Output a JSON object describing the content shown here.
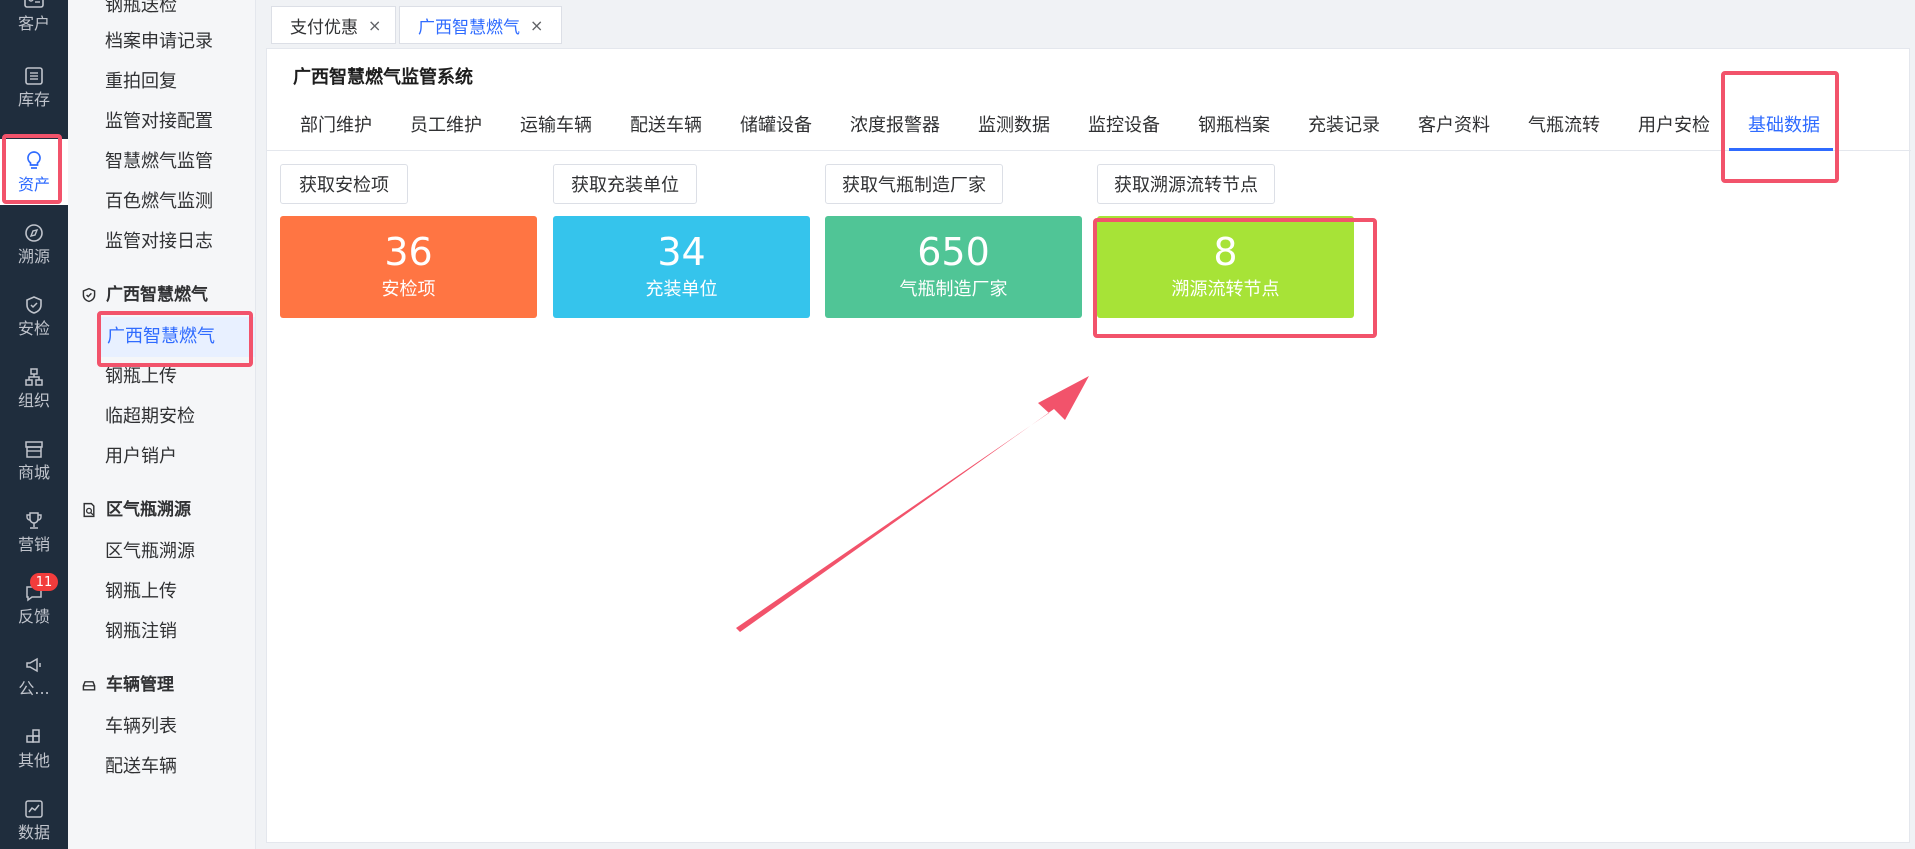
{
  "rail": {
    "items": [
      {
        "label": "",
        "icon": "contact-card-icon"
      },
      {
        "label": "客户",
        "icon": "contact-card-icon"
      },
      {
        "label": "库存",
        "icon": "inventory-icon"
      },
      {
        "label": "资产",
        "icon": "lightbulb-icon",
        "active": true
      },
      {
        "label": "溯源",
        "icon": "compass-icon"
      },
      {
        "label": "安检",
        "icon": "shield-check-icon"
      },
      {
        "label": "组织",
        "icon": "org-chart-icon"
      },
      {
        "label": "商城",
        "icon": "store-icon"
      },
      {
        "label": "营销",
        "icon": "trophy-icon"
      },
      {
        "label": "反馈",
        "icon": "feedback-icon",
        "badge": "11"
      },
      {
        "label": "公...",
        "icon": "megaphone-icon"
      },
      {
        "label": "其他",
        "icon": "grid-plus-icon"
      },
      {
        "label": "数据",
        "icon": "line-chart-icon"
      }
    ]
  },
  "submenu": {
    "top_items": [
      "钢瓶送检",
      "档案申请记录",
      "重拍回复",
      "监管对接配置",
      "智慧燃气监管",
      "百色燃气监测",
      "监管对接日志"
    ],
    "groups": [
      {
        "title": "广西智慧燃气",
        "icon": "shield-check-icon",
        "items": [
          "广西智慧燃气",
          "钢瓶上传",
          "临超期安检",
          "用户销户"
        ]
      },
      {
        "title": "区气瓶溯源",
        "icon": "document-search-icon",
        "items": [
          "区气瓶溯源",
          "钢瓶上传",
          "钢瓶注销"
        ]
      },
      {
        "title": "车辆管理",
        "icon": "car-icon",
        "items": [
          "车辆列表",
          "配送车辆"
        ]
      }
    ]
  },
  "page_tabs": [
    {
      "label": "支付优惠",
      "close": "×"
    },
    {
      "label": "广西智慧燃气",
      "close": "×",
      "active": true
    }
  ],
  "system_title": "广西智慧燃气监管系统",
  "nav_tabs": [
    "部门维护",
    "员工维护",
    "运输车辆",
    "配送车辆",
    "储罐设备",
    "浓度报警器",
    "监测数据",
    "监控设备",
    "钢瓶档案",
    "充装记录",
    "客户资料",
    "气瓶流转",
    "用户安检",
    "基础数据"
  ],
  "active_nav_tab": "基础数据",
  "fetch_buttons": [
    "获取安检项",
    "获取充装单位",
    "获取气瓶制造厂家",
    "获取溯源流转节点"
  ],
  "stats": [
    {
      "value": "36",
      "label": "安检项",
      "color": "#ff7543"
    },
    {
      "value": "34",
      "label": "充装单位",
      "color": "#35c4ec"
    },
    {
      "value": "650",
      "label": "气瓶制造厂家",
      "color": "#50c596"
    },
    {
      "value": "8",
      "label": "溯源流转节点",
      "color": "#a7e337"
    }
  ],
  "colors": {
    "accent": "#2f6bff",
    "highlight": "#f2536b",
    "rail_bg": "#1f2d3d"
  }
}
